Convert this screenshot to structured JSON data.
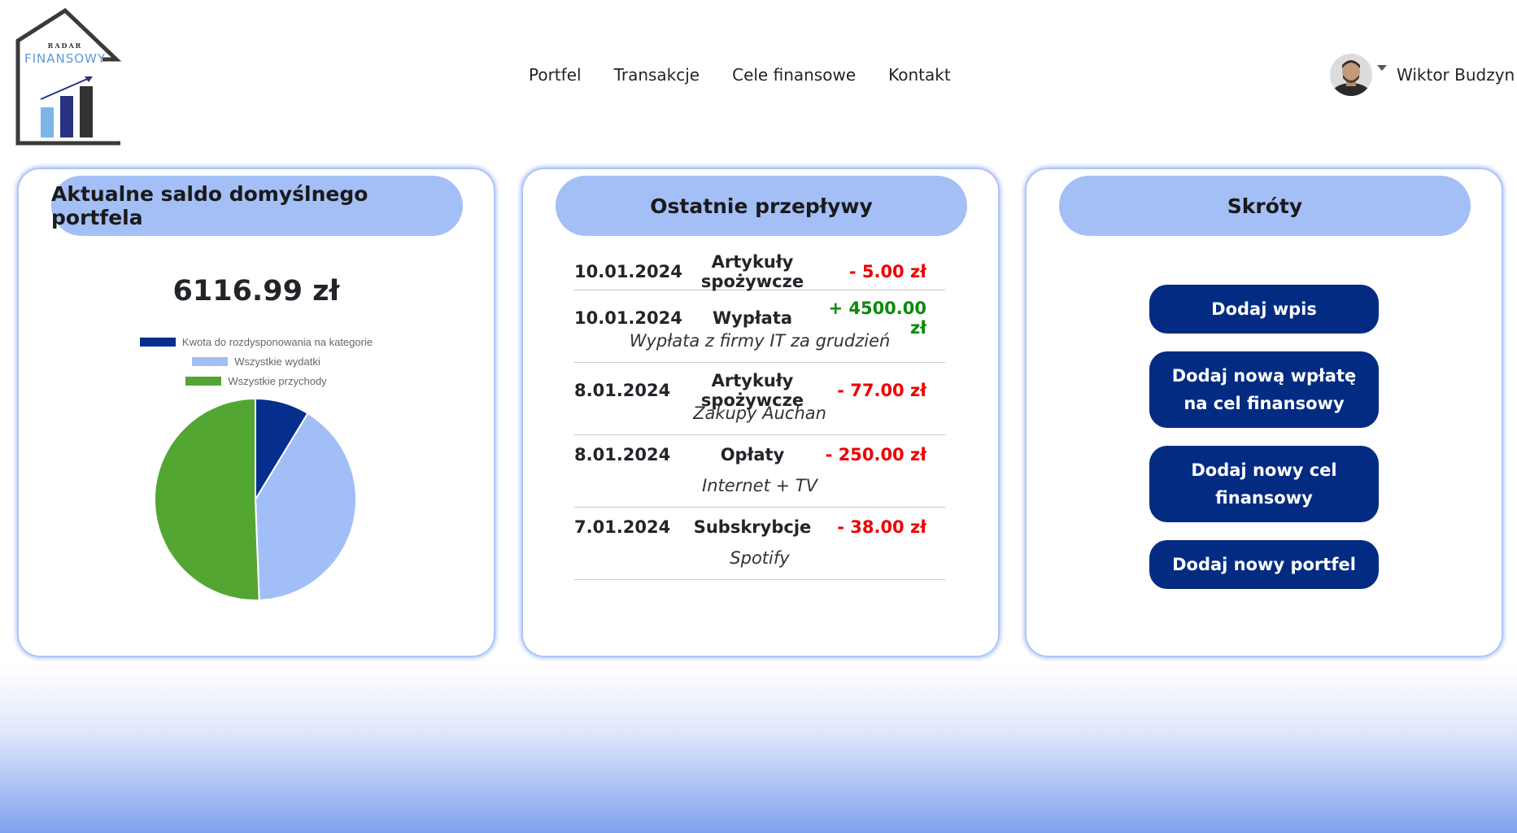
{
  "logo": {
    "top_text": "RADAR",
    "main_text": "FINANSOWY"
  },
  "nav": {
    "items": [
      {
        "label": "Portfel"
      },
      {
        "label": "Transakcje"
      },
      {
        "label": "Cele finansowe"
      },
      {
        "label": "Kontakt"
      }
    ]
  },
  "user": {
    "name": "Wiktor Budzyn"
  },
  "balance_card": {
    "title": "Aktualne saldo domyślnego portfela",
    "balance": "6116.99 zł",
    "legend": [
      {
        "label": "Kwota do rozdysponowania na kategorie",
        "color": "#062e8c"
      },
      {
        "label": "Wszystkie wydatki",
        "color": "#a1bff6"
      },
      {
        "label": "Wszystkie przychody",
        "color": "#53a632"
      }
    ]
  },
  "chart_data": {
    "type": "pie",
    "labels": [
      "Kwota do rozdysponowania na kategorie",
      "Wszystkie wydatki",
      "Wszystkie przychody"
    ],
    "values": [
      8.7,
      40.7,
      50.6
    ],
    "colors": [
      "#062e8c",
      "#a1bff6",
      "#53a632"
    ],
    "legend_position": "top"
  },
  "flows_card": {
    "title": "Ostatnie przepływy",
    "items": [
      {
        "date": "10.01.2024",
        "category": "Artykuły spożywcze",
        "amount": "- 5.00 zł",
        "sign": "neg",
        "note": ""
      },
      {
        "date": "10.01.2024",
        "category": "Wypłata",
        "amount": "+ 4500.00 zł",
        "sign": "pos",
        "note": "Wypłata z firmy IT za grudzień"
      },
      {
        "date": "8.01.2024",
        "category": "Artykuły spożywcze",
        "amount": "- 77.00 zł",
        "sign": "neg",
        "note": "Zakupy Auchan"
      },
      {
        "date": "8.01.2024",
        "category": "Opłaty",
        "amount": "- 250.00 zł",
        "sign": "neg",
        "note": "Internet + TV"
      },
      {
        "date": "7.01.2024",
        "category": "Subskrybcje",
        "amount": "- 38.00 zł",
        "sign": "neg",
        "note": "Spotify"
      }
    ]
  },
  "shortcuts_card": {
    "title": "Skróty",
    "buttons": [
      {
        "label": "Dodaj wpis"
      },
      {
        "label": "Dodaj nową wpłatę na cel finansowy"
      },
      {
        "label": "Dodaj nowy cel finansowy"
      },
      {
        "label": "Dodaj nowy portfel"
      }
    ]
  },
  "colors": {
    "header_pill": "#a3bff6",
    "button": "#032b82",
    "negative": "#ee0000",
    "positive": "#0a8a0a"
  }
}
